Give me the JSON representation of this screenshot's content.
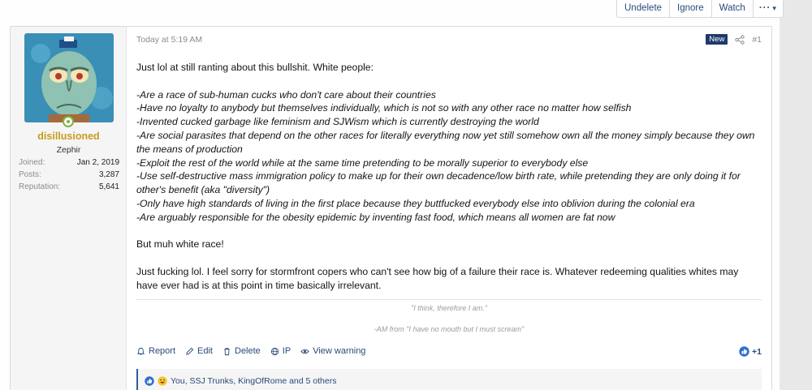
{
  "toolbar": {
    "undelete": "Undelete",
    "ignore": "Ignore",
    "watch": "Watch",
    "more": "···"
  },
  "user": {
    "name": "disillusioned",
    "title": "Zephir",
    "stats": [
      {
        "label": "Joined:",
        "value": "Jan 2, 2019"
      },
      {
        "label": "Posts:",
        "value": "3,287"
      },
      {
        "label": "Reputation:",
        "value": "5,641"
      }
    ]
  },
  "post": {
    "date": "Today at 5:19 AM",
    "badge": "New",
    "number": "#1",
    "intro": "Just lol at still ranting about this bullshit. White people:",
    "list": [
      "-Are a race of sub-human cucks who don't care about their countries",
      "-Have no loyalty to anybody but themselves individually, which is not so with any other race no matter how selfish",
      "-Invented cucked garbage like feminism and SJWism which is currently destroying the world",
      "-Are social parasites that depend on the other races for literally everything now yet still somehow own all the money simply because they own the means of production",
      "-Exploit the rest of the world while at the same time pretending to be morally superior to everybody else",
      "-Use self-destructive mass immigration policy to make up for their own decadence/low birth rate, while pretending they are only doing it for other's benefit (aka \"diversity\")",
      "-Only have high standards of living in the first place because they buttfucked everybody else into oblivion during the colonial era",
      "-Are arguably responsible for the obesity epidemic by inventing fast food, which means all women are fat now"
    ],
    "line2": "But muh white race!",
    "line3": "Just fucking lol. I feel sorry for stormfront copers who can't see how big of a failure their race is. Whatever redeeming qualities whites may have ever had is at this point in time basically irrelevant."
  },
  "signature": {
    "line1": "\"I think, therefore I am.\"",
    "line2": "-AM from \"I have no mouth but I must scream\""
  },
  "actions": {
    "report": "Report",
    "edit": "Edit",
    "delete": "Delete",
    "ip": "IP",
    "warning": "View warning",
    "score": "+1"
  },
  "reactions": {
    "text": "You, SSJ Trunks, KingOfRome and 5 others"
  },
  "colors": {
    "accent": "#2a4a7a",
    "username": "#c89b1e",
    "badge": "#1f3a6b",
    "online": "#7cb342"
  }
}
